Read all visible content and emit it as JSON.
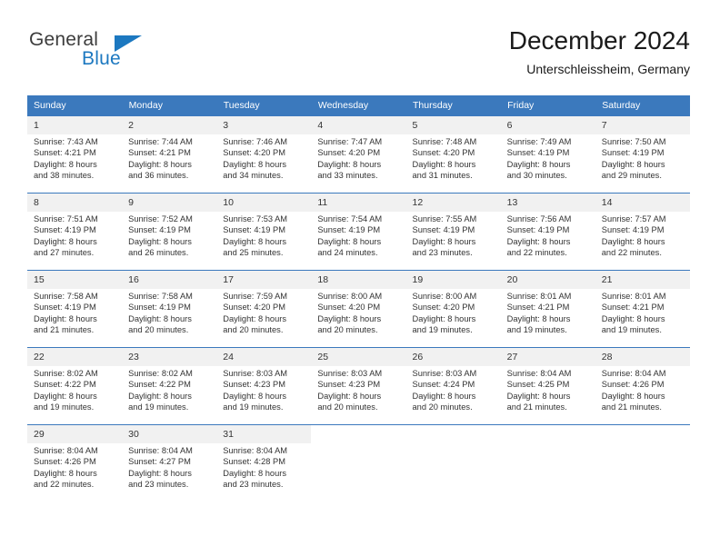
{
  "brand": {
    "name_top": "General",
    "name_bottom": "Blue",
    "accent_color": "#1c78c0"
  },
  "header": {
    "title": "December 2024",
    "subtitle": "Unterschleissheim, Germany"
  },
  "theme": {
    "header_blue": "#3b79bd",
    "daynum_bg": "#f1f1f1",
    "text": "#333333"
  },
  "calendar": {
    "weekday_headers": [
      "Sunday",
      "Monday",
      "Tuesday",
      "Wednesday",
      "Thursday",
      "Friday",
      "Saturday"
    ],
    "weeks": [
      [
        {
          "day": "1",
          "sunrise": "Sunrise: 7:43 AM",
          "sunset": "Sunset: 4:21 PM",
          "daylight1": "Daylight: 8 hours",
          "daylight2": "and 38 minutes."
        },
        {
          "day": "2",
          "sunrise": "Sunrise: 7:44 AM",
          "sunset": "Sunset: 4:21 PM",
          "daylight1": "Daylight: 8 hours",
          "daylight2": "and 36 minutes."
        },
        {
          "day": "3",
          "sunrise": "Sunrise: 7:46 AM",
          "sunset": "Sunset: 4:20 PM",
          "daylight1": "Daylight: 8 hours",
          "daylight2": "and 34 minutes."
        },
        {
          "day": "4",
          "sunrise": "Sunrise: 7:47 AM",
          "sunset": "Sunset: 4:20 PM",
          "daylight1": "Daylight: 8 hours",
          "daylight2": "and 33 minutes."
        },
        {
          "day": "5",
          "sunrise": "Sunrise: 7:48 AM",
          "sunset": "Sunset: 4:20 PM",
          "daylight1": "Daylight: 8 hours",
          "daylight2": "and 31 minutes."
        },
        {
          "day": "6",
          "sunrise": "Sunrise: 7:49 AM",
          "sunset": "Sunset: 4:19 PM",
          "daylight1": "Daylight: 8 hours",
          "daylight2": "and 30 minutes."
        },
        {
          "day": "7",
          "sunrise": "Sunrise: 7:50 AM",
          "sunset": "Sunset: 4:19 PM",
          "daylight1": "Daylight: 8 hours",
          "daylight2": "and 29 minutes."
        }
      ],
      [
        {
          "day": "8",
          "sunrise": "Sunrise: 7:51 AM",
          "sunset": "Sunset: 4:19 PM",
          "daylight1": "Daylight: 8 hours",
          "daylight2": "and 27 minutes."
        },
        {
          "day": "9",
          "sunrise": "Sunrise: 7:52 AM",
          "sunset": "Sunset: 4:19 PM",
          "daylight1": "Daylight: 8 hours",
          "daylight2": "and 26 minutes."
        },
        {
          "day": "10",
          "sunrise": "Sunrise: 7:53 AM",
          "sunset": "Sunset: 4:19 PM",
          "daylight1": "Daylight: 8 hours",
          "daylight2": "and 25 minutes."
        },
        {
          "day": "11",
          "sunrise": "Sunrise: 7:54 AM",
          "sunset": "Sunset: 4:19 PM",
          "daylight1": "Daylight: 8 hours",
          "daylight2": "and 24 minutes."
        },
        {
          "day": "12",
          "sunrise": "Sunrise: 7:55 AM",
          "sunset": "Sunset: 4:19 PM",
          "daylight1": "Daylight: 8 hours",
          "daylight2": "and 23 minutes."
        },
        {
          "day": "13",
          "sunrise": "Sunrise: 7:56 AM",
          "sunset": "Sunset: 4:19 PM",
          "daylight1": "Daylight: 8 hours",
          "daylight2": "and 22 minutes."
        },
        {
          "day": "14",
          "sunrise": "Sunrise: 7:57 AM",
          "sunset": "Sunset: 4:19 PM",
          "daylight1": "Daylight: 8 hours",
          "daylight2": "and 22 minutes."
        }
      ],
      [
        {
          "day": "15",
          "sunrise": "Sunrise: 7:58 AM",
          "sunset": "Sunset: 4:19 PM",
          "daylight1": "Daylight: 8 hours",
          "daylight2": "and 21 minutes."
        },
        {
          "day": "16",
          "sunrise": "Sunrise: 7:58 AM",
          "sunset": "Sunset: 4:19 PM",
          "daylight1": "Daylight: 8 hours",
          "daylight2": "and 20 minutes."
        },
        {
          "day": "17",
          "sunrise": "Sunrise: 7:59 AM",
          "sunset": "Sunset: 4:20 PM",
          "daylight1": "Daylight: 8 hours",
          "daylight2": "and 20 minutes."
        },
        {
          "day": "18",
          "sunrise": "Sunrise: 8:00 AM",
          "sunset": "Sunset: 4:20 PM",
          "daylight1": "Daylight: 8 hours",
          "daylight2": "and 20 minutes."
        },
        {
          "day": "19",
          "sunrise": "Sunrise: 8:00 AM",
          "sunset": "Sunset: 4:20 PM",
          "daylight1": "Daylight: 8 hours",
          "daylight2": "and 19 minutes."
        },
        {
          "day": "20",
          "sunrise": "Sunrise: 8:01 AM",
          "sunset": "Sunset: 4:21 PM",
          "daylight1": "Daylight: 8 hours",
          "daylight2": "and 19 minutes."
        },
        {
          "day": "21",
          "sunrise": "Sunrise: 8:01 AM",
          "sunset": "Sunset: 4:21 PM",
          "daylight1": "Daylight: 8 hours",
          "daylight2": "and 19 minutes."
        }
      ],
      [
        {
          "day": "22",
          "sunrise": "Sunrise: 8:02 AM",
          "sunset": "Sunset: 4:22 PM",
          "daylight1": "Daylight: 8 hours",
          "daylight2": "and 19 minutes."
        },
        {
          "day": "23",
          "sunrise": "Sunrise: 8:02 AM",
          "sunset": "Sunset: 4:22 PM",
          "daylight1": "Daylight: 8 hours",
          "daylight2": "and 19 minutes."
        },
        {
          "day": "24",
          "sunrise": "Sunrise: 8:03 AM",
          "sunset": "Sunset: 4:23 PM",
          "daylight1": "Daylight: 8 hours",
          "daylight2": "and 19 minutes."
        },
        {
          "day": "25",
          "sunrise": "Sunrise: 8:03 AM",
          "sunset": "Sunset: 4:23 PM",
          "daylight1": "Daylight: 8 hours",
          "daylight2": "and 20 minutes."
        },
        {
          "day": "26",
          "sunrise": "Sunrise: 8:03 AM",
          "sunset": "Sunset: 4:24 PM",
          "daylight1": "Daylight: 8 hours",
          "daylight2": "and 20 minutes."
        },
        {
          "day": "27",
          "sunrise": "Sunrise: 8:04 AM",
          "sunset": "Sunset: 4:25 PM",
          "daylight1": "Daylight: 8 hours",
          "daylight2": "and 21 minutes."
        },
        {
          "day": "28",
          "sunrise": "Sunrise: 8:04 AM",
          "sunset": "Sunset: 4:26 PM",
          "daylight1": "Daylight: 8 hours",
          "daylight2": "and 21 minutes."
        }
      ],
      [
        {
          "day": "29",
          "sunrise": "Sunrise: 8:04 AM",
          "sunset": "Sunset: 4:26 PM",
          "daylight1": "Daylight: 8 hours",
          "daylight2": "and 22 minutes."
        },
        {
          "day": "30",
          "sunrise": "Sunrise: 8:04 AM",
          "sunset": "Sunset: 4:27 PM",
          "daylight1": "Daylight: 8 hours",
          "daylight2": "and 23 minutes."
        },
        {
          "day": "31",
          "sunrise": "Sunrise: 8:04 AM",
          "sunset": "Sunset: 4:28 PM",
          "daylight1": "Daylight: 8 hours",
          "daylight2": "and 23 minutes."
        },
        {
          "day": "",
          "sunrise": "",
          "sunset": "",
          "daylight1": "",
          "daylight2": ""
        },
        {
          "day": "",
          "sunrise": "",
          "sunset": "",
          "daylight1": "",
          "daylight2": ""
        },
        {
          "day": "",
          "sunrise": "",
          "sunset": "",
          "daylight1": "",
          "daylight2": ""
        },
        {
          "day": "",
          "sunrise": "",
          "sunset": "",
          "daylight1": "",
          "daylight2": ""
        }
      ]
    ]
  }
}
